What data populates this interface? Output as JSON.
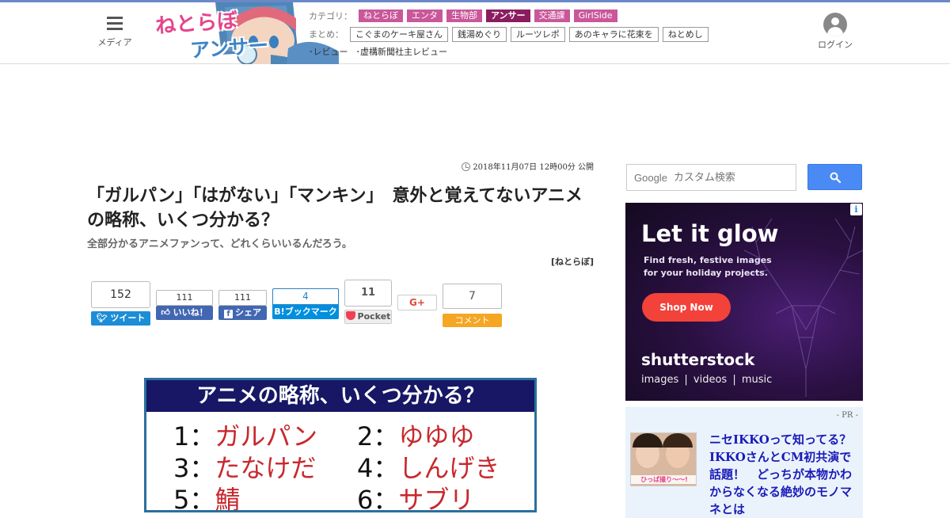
{
  "header": {
    "menu_label": "メディア",
    "logo_line1": "ねとらぼ",
    "logo_line2": "アンサー",
    "category_label": "カテゴリ：",
    "categories": [
      "ねとらぼ",
      "エンタ",
      "生物部",
      "アンサー",
      "交通課",
      "GirlSide"
    ],
    "active_category": "アンサー",
    "matome_label": "まとめ：",
    "matome": [
      "こぐまのケーキ屋さん",
      "銭湯めぐり",
      "ルーツレポ",
      "あのキャラに花束を",
      "ねとめし"
    ],
    "reviews": [
      "･レビュー",
      "･虚構新聞社主レビュー"
    ],
    "login_label": "ログイン",
    "colors": {
      "category_tag": "#c9579a",
      "active_tag": "#8a1d5f",
      "top_line": "#6b88c7"
    }
  },
  "article": {
    "pubdate": "2018年11月07日 12時00分 公開",
    "title": "「ガルパン」「はがない」「マンキン」　意外と覚えてないアニメの略称、いくつ分かる？",
    "subtitle": "全部分かるアニメファンって、どれくらいいるんだろう。",
    "source": "[ねとらぼ]",
    "share": {
      "tweet_count": "152",
      "tweet_label": "ツイート",
      "like_count": "111",
      "like_label": "いいね！",
      "share_count": "111",
      "share_label": "シェア",
      "hatena_count": "4",
      "hatena_label": "B!ブックマーク",
      "pocket_count": "11",
      "pocket_label": "Pocket",
      "gplus_label": "G+",
      "comment_count": "7",
      "comment_label": "コメント"
    },
    "image": {
      "banner": "アニメの略称、いくつ分かる？",
      "items": [
        {
          "num": "1：",
          "word": "ガルパン"
        },
        {
          "num": "2：",
          "word": "ゆゆゆ"
        },
        {
          "num": "3：",
          "word": "たなけだ"
        },
        {
          "num": "4：",
          "word": "しんげき"
        },
        {
          "num": "5：",
          "word": "鯖"
        },
        {
          "num": "6：",
          "word": "サブリ"
        }
      ]
    }
  },
  "sidebar": {
    "search_brand": "Google",
    "search_placeholder": "カスタム検索",
    "ad": {
      "headline": "Let it glow",
      "sub": "Find fresh, festive images for your holiday projects.",
      "cta": "Shop Now",
      "brand": "shutterstock",
      "links": "images  |  videos  |  music",
      "info": "i"
    },
    "pr": {
      "label": "- PR -",
      "thumb_caption": "ひっぱ撮り〜〜!",
      "title": "ニセIKKOって知ってる？　IKKOさんとCM初共演で話題！　どっちが本物かわからなくなる絶妙のモノマネとは"
    }
  }
}
